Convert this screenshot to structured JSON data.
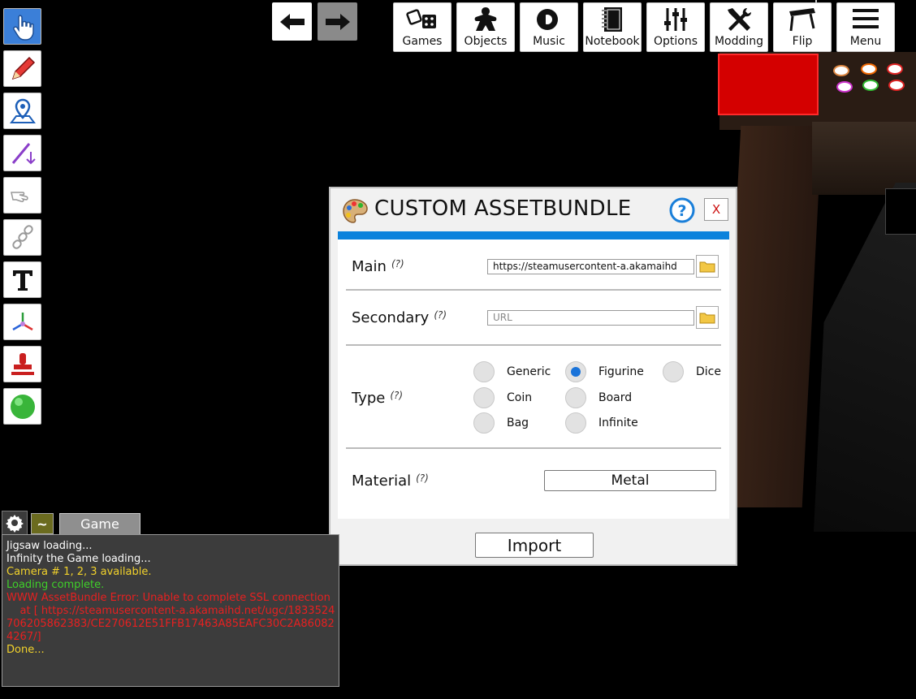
{
  "left_tools": [
    {
      "name": "grab-hand-icon",
      "active": true
    },
    {
      "name": "pencil-icon",
      "active": false
    },
    {
      "name": "map-pin-icon",
      "active": false
    },
    {
      "name": "line-arrow-icon",
      "active": false
    },
    {
      "name": "flick-hand-icon",
      "active": false
    },
    {
      "name": "joint-chain-icon",
      "active": false
    },
    {
      "name": "text-icon",
      "active": false
    },
    {
      "name": "gizmo-axes-icon",
      "active": false
    },
    {
      "name": "stamp-icon",
      "active": false
    },
    {
      "name": "green-ball-icon",
      "active": false
    }
  ],
  "top_menu": [
    {
      "label": "Games",
      "icon": "dice-icon"
    },
    {
      "label": "Objects",
      "icon": "meeple-icon"
    },
    {
      "label": "Music",
      "icon": "speaker-icon"
    },
    {
      "label": "Notebook",
      "icon": "notebook-icon"
    },
    {
      "label": "Options",
      "icon": "sliders-icon"
    },
    {
      "label": "Modding",
      "icon": "tools-icon"
    },
    {
      "label": "Flip",
      "icon": "flip-table-icon"
    },
    {
      "label": "Menu",
      "icon": "hamburger-icon"
    }
  ],
  "dialog": {
    "title": "CUSTOM ASSETBUNDLE",
    "close": "X",
    "help_hint": "(?)",
    "main": {
      "label": "Main",
      "value": "https://steamusercontent-a.akamaihd"
    },
    "secondary": {
      "label": "Secondary",
      "placeholder": "URL"
    },
    "type": {
      "label": "Type",
      "options": [
        "Generic",
        "Figurine",
        "Dice",
        "Coin",
        "Board",
        "Bag",
        "Infinite"
      ],
      "selected": "Figurine"
    },
    "material": {
      "label": "Material",
      "value": "Metal"
    },
    "import": "Import"
  },
  "console": {
    "tilde": "~",
    "tab": "Game",
    "lines": [
      {
        "text": "Jigsaw loading...",
        "color": "#ffffff"
      },
      {
        "text": "Infinity the Game loading...",
        "color": "#ffffff"
      },
      {
        "text": "Camera # 1, 2, 3 available.",
        "color": "#f2d22b"
      },
      {
        "text": "Loading complete.",
        "color": "#3fcf2a"
      },
      {
        "text": "WWW AssetBundle Error: Unable to complete SSL connection",
        "color": "#e82020"
      },
      {
        "text": "    at [ https://steamusercontent-a.akamaihd.net/ugc/1833524706205862383/CE270612E51FFB17463A85EAFC30C2A860824267/]",
        "color": "#e82020"
      },
      {
        "text": "Done...",
        "color": "#f2d22b"
      }
    ]
  },
  "colors": {
    "accent": "#0b82dc",
    "radio_selected": "#1a73d9",
    "tool_active": "#3b7fd8"
  }
}
